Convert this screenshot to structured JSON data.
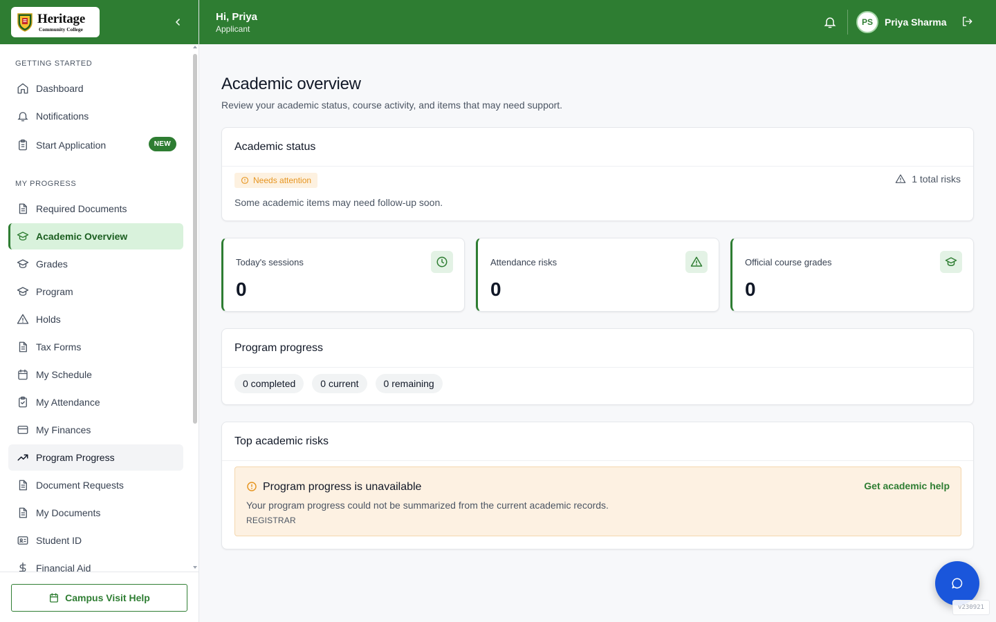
{
  "brand": {
    "name": "Heritage",
    "subtitle": "Community College"
  },
  "topbar": {
    "greeting": "Hi, Priya",
    "role": "Applicant",
    "user_initials": "PS",
    "user_name": "Priya Sharma"
  },
  "sidebar": {
    "section_getting_started": "GETTING STARTED",
    "section_my_progress": "MY PROGRESS",
    "getting_started": [
      {
        "label": "Dashboard",
        "icon": "home-icon"
      },
      {
        "label": "Notifications",
        "icon": "bell-icon"
      },
      {
        "label": "Start Application",
        "icon": "clipboard-icon",
        "badge": "NEW"
      }
    ],
    "progress": [
      {
        "label": "Required Documents",
        "icon": "document-icon"
      },
      {
        "label": "Academic Overview",
        "icon": "graduation-cap-icon",
        "active": true
      },
      {
        "label": "Grades",
        "icon": "graduation-cap-icon"
      },
      {
        "label": "Program",
        "icon": "graduation-cap-icon"
      },
      {
        "label": "Holds",
        "icon": "warning-icon"
      },
      {
        "label": "Tax Forms",
        "icon": "document-icon"
      },
      {
        "label": "My Schedule",
        "icon": "calendar-icon"
      },
      {
        "label": "My Attendance",
        "icon": "clipboard-check-icon"
      },
      {
        "label": "My Finances",
        "icon": "credit-card-icon"
      },
      {
        "label": "Program Progress",
        "icon": "trending-up-icon"
      },
      {
        "label": "Document Requests",
        "icon": "document-icon"
      },
      {
        "label": "My Documents",
        "icon": "document-icon"
      },
      {
        "label": "Student ID",
        "icon": "id-card-icon"
      },
      {
        "label": "Financial Aid",
        "icon": "dollar-icon"
      }
    ],
    "footer_button": "Campus Visit Help"
  },
  "page": {
    "title": "Academic overview",
    "subtitle": "Review your academic status, course activity, and items that may need support."
  },
  "academic_status": {
    "heading": "Academic status",
    "status": "Needs attention",
    "risk_count": "1 total risks",
    "description": "Some academic items may need follow-up soon."
  },
  "stats": [
    {
      "label": "Today's sessions",
      "value": "0",
      "icon": "clock-icon"
    },
    {
      "label": "Attendance risks",
      "value": "0",
      "icon": "warning-icon"
    },
    {
      "label": "Official course grades",
      "value": "0",
      "icon": "graduation-cap-icon"
    }
  ],
  "program_progress": {
    "heading": "Program progress",
    "completed": "0 completed",
    "current": "0 current",
    "remaining": "0 remaining"
  },
  "top_risks": {
    "heading": "Top academic risks",
    "items": [
      {
        "title": "Program progress is unavailable",
        "text": "Your program progress could not be summarized from the current academic records.",
        "category": "REGISTRAR",
        "action": "Get academic help"
      }
    ]
  },
  "version": "v230921",
  "colors": {
    "primary": "#2e7d32",
    "warning": "#e69520",
    "fab": "#1a56db"
  }
}
